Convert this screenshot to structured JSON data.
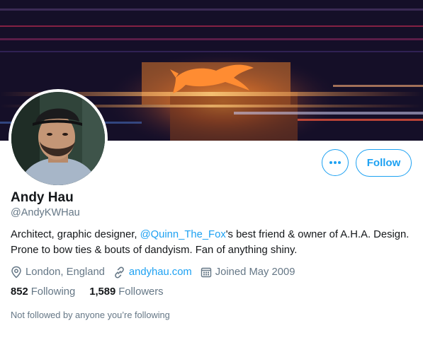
{
  "profile": {
    "name": "Andy Hau",
    "handle": "@AndyKWHau",
    "bio": {
      "prefix": "Architect, graphic designer, ",
      "mention": "@Quinn_The_Fox",
      "suffix": "'s best friend & owner of A.H.A. Design. Prone to bow ties & bouts of dandyism. Fan of anything shiny."
    },
    "location": "London, England",
    "website": "andyhau.com",
    "joined": "Joined May 2009"
  },
  "actions": {
    "follow_label": "Follow",
    "more_icon": "more-dots-icon"
  },
  "stats": {
    "following_count": "852",
    "following_label": "Following",
    "followers_count": "1,589",
    "followers_label": "Followers"
  },
  "followed_by_text": "Not followed by anyone you’re following",
  "colors": {
    "accent": "#1da1f2",
    "text_primary": "#14171a",
    "text_secondary": "#657786"
  },
  "icons": {
    "location": "location-pin-icon",
    "website": "link-icon",
    "joined": "calendar-icon"
  }
}
